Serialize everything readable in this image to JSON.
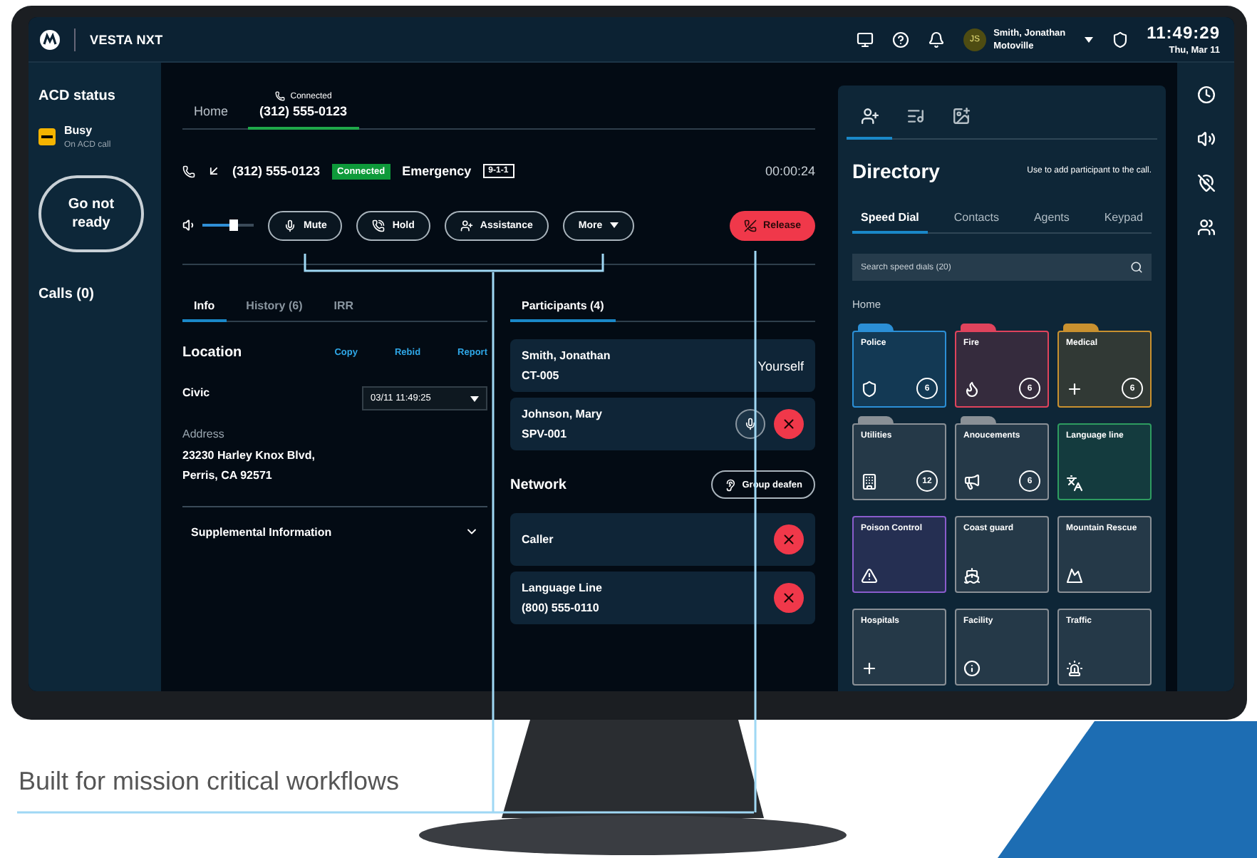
{
  "app": {
    "name": "VESTA NXT"
  },
  "header": {
    "user_initials": "JS",
    "user_name": "Smith, Jonathan",
    "user_location": "Motoville",
    "time": "11:49:29",
    "date": "Thu, Mar 11"
  },
  "sidebar": {
    "title": "ACD status",
    "status": {
      "label": "Busy",
      "detail": "On ACD call",
      "color": "#f5b400"
    },
    "button": "Go not ready",
    "calls": "Calls (0)"
  },
  "call_tabs": [
    {
      "kind": "plain",
      "label": "Home",
      "selected": false
    },
    {
      "kind": "call",
      "status": "Connected",
      "label": "(312) 555-0123",
      "selected": true
    }
  ],
  "call": {
    "number": "(312) 555-0123",
    "status": "Connected",
    "type": "Emergency",
    "code": "9-1-1",
    "timer": "00:00:24",
    "volume": {
      "level": 0.6
    },
    "actions": [
      {
        "kind": "button",
        "label": "Mute"
      },
      {
        "kind": "button",
        "label": "Hold"
      },
      {
        "kind": "button",
        "label": "Assistance"
      },
      {
        "kind": "menu",
        "label": "More"
      }
    ],
    "release": "Release"
  },
  "info_tabs": [
    {
      "label": "Info",
      "selected": true
    },
    {
      "label": "History (6)",
      "selected": false
    },
    {
      "label": "IRR",
      "selected": false
    }
  ],
  "location": {
    "title": "Location",
    "links": [
      "Copy",
      "Rebid",
      "Report"
    ],
    "type": "Civic",
    "timestamp": "03/11 11:49:25",
    "address_label": "Address",
    "address": [
      "23230 Harley Knox Blvd,",
      "Perris, CA 92571"
    ],
    "supplemental": "Supplemental Information",
    "expanded": false
  },
  "participant_tabs": [
    {
      "label": "Participants (4)",
      "selected": true
    }
  ],
  "participants": [
    {
      "kind": "self",
      "name": "Smith, Jonathan",
      "id": "CT-005",
      "note": "Yourself"
    },
    {
      "kind": "member",
      "name": "Johnson, Mary",
      "id": "SPV-001"
    }
  ],
  "network": {
    "title": "Network",
    "button": "Group deafen",
    "members": [
      {
        "name": "Caller"
      },
      {
        "name": "Language Line",
        "number": "(800) 555-0110"
      }
    ]
  },
  "directory": {
    "tabs": [
      {
        "selected": true
      },
      {
        "selected": false
      },
      {
        "selected": false
      }
    ],
    "title": "Directory",
    "hint": "Use to add participant to the call.",
    "subtabs": [
      {
        "label": "Speed Dial",
        "selected": true
      },
      {
        "label": "Contacts",
        "selected": false
      },
      {
        "label": "Agents",
        "selected": false
      },
      {
        "label": "Keypad",
        "selected": false
      }
    ],
    "search": {
      "placeholder": "Search speed dials (20)"
    },
    "breadcrumb": "Home",
    "tiles": [
      {
        "label": "Police",
        "count": "6",
        "color": "#2b8fd6",
        "folder": true
      },
      {
        "label": "Fire",
        "count": "6",
        "color": "#e0435c",
        "folder": true
      },
      {
        "label": "Medical",
        "count": "6",
        "color": "#c9912f",
        "folder": true
      },
      {
        "label": "Utilities",
        "count": "12",
        "color": "#8a9096",
        "folder": true
      },
      {
        "label": "Anoucements",
        "count": "6",
        "color": "#8a9096",
        "folder": true
      },
      {
        "label": "Language line",
        "color": "#2e9c60",
        "folder": false
      },
      {
        "label": "Poison Control",
        "color": "#8a5ccc",
        "folder": false
      },
      {
        "label": "Coast guard",
        "color": "#8a9096",
        "folder": false
      },
      {
        "label": "Mountain Rescue",
        "color": "#8a9096",
        "folder": false
      },
      {
        "label": "Hospitals",
        "color": "#8a9096",
        "folder": false
      },
      {
        "label": "Facility",
        "color": "#8a9096",
        "folder": false
      },
      {
        "label": "Traffic",
        "color": "#8a9096",
        "folder": false
      }
    ]
  },
  "caption": "Built for mission critical workflows"
}
